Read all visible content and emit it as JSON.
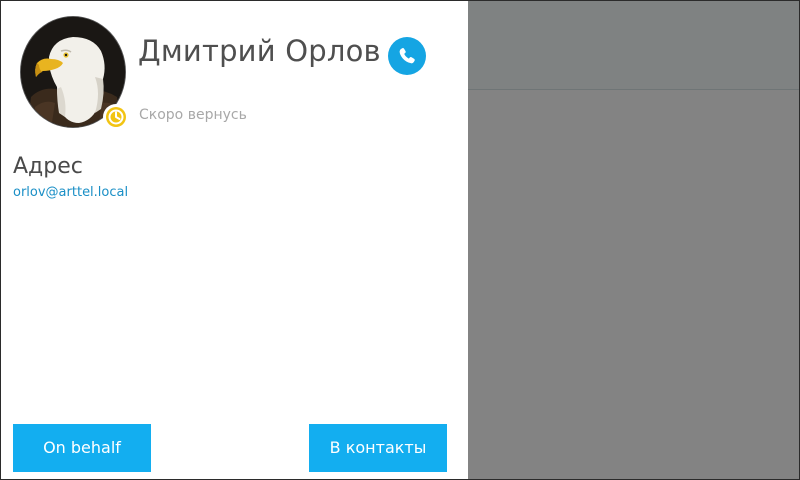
{
  "contact": {
    "name": "Дмитрий Орлов",
    "status_text": "Скоро вернусь",
    "status_color": "#f2c413",
    "avatar_icon": "eagle-avatar"
  },
  "address": {
    "heading": "Адрес",
    "email": "orlov@arttel.local"
  },
  "actions": {
    "call_icon": "phone-icon",
    "on_behalf_label": "On behalf",
    "add_contact_label": "В контакты"
  },
  "colors": {
    "accent": "#13aef0",
    "link": "#1a8fc6",
    "backdrop": "#838383"
  }
}
